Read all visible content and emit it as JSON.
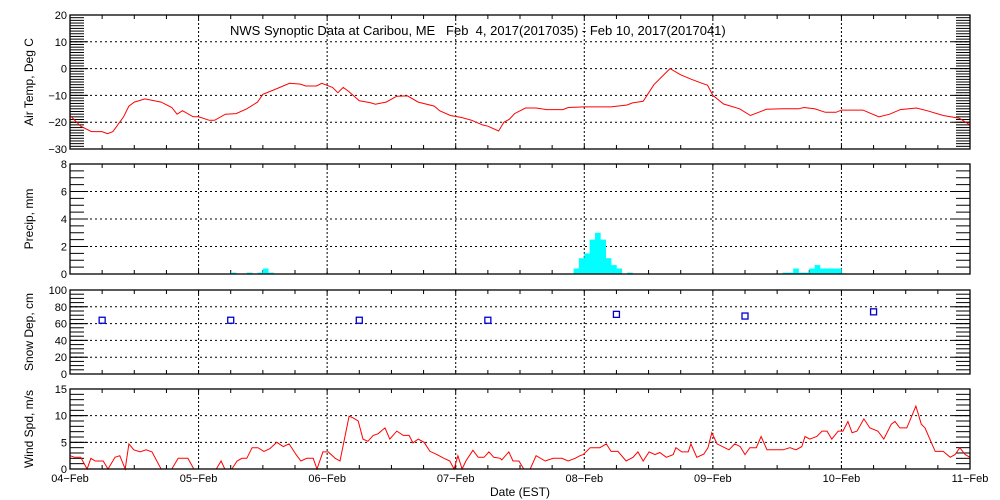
{
  "chart_data": [
    {
      "type": "line",
      "id": "temp",
      "title": "NWS Synoptic Data at Caribou, ME   Feb  4, 2017(2017035) - Feb 10, 2017(2017041)",
      "ylabel": "Air Temp, Deg C",
      "ylim": [
        -30,
        20
      ],
      "yticks": [
        20,
        10,
        0,
        -10,
        -20,
        -30
      ],
      "yminor": 1,
      "x_unit": "hours since 04-Feb 00:00 EST",
      "color": "#ff0000",
      "points": [
        [
          0,
          -17.5
        ],
        [
          2,
          -21.5
        ],
        [
          4,
          -23.5
        ],
        [
          6,
          -23.5
        ],
        [
          7,
          -24.3
        ],
        [
          8,
          -23.5
        ],
        [
          10,
          -18
        ],
        [
          11,
          -14
        ],
        [
          12,
          -12.5
        ],
        [
          14,
          -11.3
        ],
        [
          17,
          -12.5
        ],
        [
          19,
          -14.5
        ],
        [
          20,
          -17
        ],
        [
          21,
          -15.7
        ],
        [
          23,
          -18
        ],
        [
          24,
          -18
        ],
        [
          26,
          -19.3
        ],
        [
          27,
          -19.3
        ],
        [
          29,
          -17
        ],
        [
          31,
          -16.8
        ],
        [
          33,
          -15
        ],
        [
          35,
          -12.5
        ],
        [
          36,
          -9.6
        ],
        [
          38,
          -8
        ],
        [
          41,
          -5.5
        ],
        [
          43,
          -5.8
        ],
        [
          44,
          -6.5
        ],
        [
          46,
          -6.5
        ],
        [
          47,
          -5.5
        ],
        [
          49,
          -7
        ],
        [
          50,
          -9
        ],
        [
          51,
          -7
        ],
        [
          52,
          -8.5
        ],
        [
          54,
          -12
        ],
        [
          56,
          -12.7
        ],
        [
          57,
          -13.3
        ],
        [
          59,
          -12.5
        ],
        [
          61,
          -10.3
        ],
        [
          63,
          -10.2
        ],
        [
          65,
          -12.5
        ],
        [
          68,
          -14
        ],
        [
          69,
          -15.7
        ],
        [
          71,
          -17.5
        ],
        [
          73,
          -18.2
        ],
        [
          75,
          -19.3
        ],
        [
          77,
          -21
        ],
        [
          78,
          -21.5
        ],
        [
          80,
          -23.3
        ],
        [
          81,
          -20
        ],
        [
          82,
          -18.9
        ],
        [
          83,
          -16.8
        ],
        [
          85,
          -14.7
        ],
        [
          87,
          -14.7
        ],
        [
          89,
          -15.3
        ],
        [
          92,
          -15.3
        ],
        [
          93,
          -14.5
        ],
        [
          96,
          -14.3
        ],
        [
          101,
          -14.3
        ],
        [
          104,
          -13.6
        ],
        [
          105,
          -12.8
        ],
        [
          107,
          -12.2
        ],
        [
          109,
          -6
        ],
        [
          112,
          0
        ],
        [
          114,
          -2.3
        ],
        [
          116,
          -4
        ],
        [
          118,
          -5.5
        ],
        [
          119,
          -6.2
        ],
        [
          120,
          -10
        ],
        [
          122,
          -13.2
        ],
        [
          125,
          -15
        ],
        [
          127,
          -17.5
        ],
        [
          130,
          -15.2
        ],
        [
          133,
          -15
        ],
        [
          136,
          -15
        ],
        [
          137,
          -14.5
        ],
        [
          139,
          -15
        ],
        [
          141,
          -16.3
        ],
        [
          143,
          -16.3
        ],
        [
          144,
          -15.5
        ],
        [
          148,
          -15.5
        ],
        [
          151,
          -18
        ],
        [
          153,
          -17
        ],
        [
          155,
          -15.3
        ],
        [
          158,
          -14.7
        ],
        [
          160,
          -15.7
        ],
        [
          163,
          -17.5
        ],
        [
          166,
          -18.5
        ],
        [
          168,
          -21
        ]
      ]
    },
    {
      "type": "bar",
      "id": "precip",
      "ylabel": "Precip, mm",
      "ylim": [
        0,
        8
      ],
      "yticks": [
        8,
        6,
        4,
        2,
        0
      ],
      "yminor": 0.5,
      "x_unit": "hour index (1-hour bins) since 04-Feb 00:00 EST",
      "color": "#00ffff",
      "bars": [
        [
          30,
          0.1
        ],
        [
          33,
          0.1
        ],
        [
          35,
          0.1
        ],
        [
          36,
          0.4
        ],
        [
          37,
          0.1
        ],
        [
          94,
          0.4
        ],
        [
          95,
          1.15
        ],
        [
          96,
          1.5
        ],
        [
          97,
          2.5
        ],
        [
          98,
          3.0
        ],
        [
          99,
          2.5
        ],
        [
          100,
          1.15
        ],
        [
          101,
          0.65
        ],
        [
          102,
          0.4
        ],
        [
          104,
          0.1
        ],
        [
          133,
          0.1
        ],
        [
          134,
          0.1
        ],
        [
          135,
          0.4
        ],
        [
          136,
          0.1
        ],
        [
          137,
          0.1
        ],
        [
          138,
          0.4
        ],
        [
          139,
          0.65
        ],
        [
          140,
          0.4
        ],
        [
          141,
          0.4
        ],
        [
          142,
          0.4
        ],
        [
          143,
          0.4
        ],
        [
          144,
          0.05
        ]
      ]
    },
    {
      "type": "scatter",
      "id": "snow",
      "ylabel": "Snow Dep, cm",
      "ylim": [
        0,
        100
      ],
      "yticks": [
        100,
        80,
        60,
        40,
        20,
        0
      ],
      "yminor": 5,
      "x_unit": "hours since 04-Feb 00:00 EST",
      "color": "#0000cc",
      "points": [
        [
          6,
          64
        ],
        [
          30,
          64
        ],
        [
          54,
          64
        ],
        [
          78,
          64
        ],
        [
          102,
          71
        ],
        [
          126,
          69
        ],
        [
          150,
          74
        ]
      ]
    },
    {
      "type": "line",
      "id": "wind",
      "ylabel": "Wind Spd, m/s",
      "xlabel": "Date (EST)",
      "ylim": [
        0,
        15
      ],
      "yticks": [
        15,
        10,
        5,
        0
      ],
      "yminor": 1,
      "x_unit": "hours since 04-Feb 00:00 EST",
      "color": "#ff0000",
      "xticks": [
        "04-Feb",
        "05-Feb",
        "06-Feb",
        "07-Feb",
        "08-Feb",
        "09-Feb",
        "10-Feb",
        "11-Feb"
      ],
      "points": [
        [
          0,
          2.5
        ],
        [
          0.9,
          2.2
        ],
        [
          2,
          2.2
        ],
        [
          3.2,
          0
        ],
        [
          3.9,
          2
        ],
        [
          4.7,
          1.5
        ],
        [
          6.2,
          1.5
        ],
        [
          7.1,
          0
        ],
        [
          8.4,
          2.2
        ],
        [
          9.3,
          2.5
        ],
        [
          10.3,
          0
        ],
        [
          11,
          4.7
        ],
        [
          11.9,
          3.6
        ],
        [
          13.1,
          3.2
        ],
        [
          14.2,
          3.6
        ],
        [
          15.3,
          3.2
        ],
        [
          17,
          0
        ],
        [
          19,
          0
        ],
        [
          20.2,
          2
        ],
        [
          22,
          2
        ],
        [
          23.1,
          0
        ],
        [
          27.3,
          0
        ],
        [
          28.2,
          1.5
        ],
        [
          28.9,
          0
        ],
        [
          30.2,
          0
        ],
        [
          31.2,
          1.5
        ],
        [
          32.1,
          2
        ],
        [
          33,
          2
        ],
        [
          34,
          4
        ],
        [
          35.1,
          4
        ],
        [
          36.2,
          3.3
        ],
        [
          37.3,
          3.8
        ],
        [
          38.6,
          5
        ],
        [
          39.8,
          4.2
        ],
        [
          40.9,
          4.7
        ],
        [
          42.2,
          2.7
        ],
        [
          43.1,
          1.5
        ],
        [
          44.2,
          2
        ],
        [
          45.4,
          2
        ],
        [
          46.1,
          0
        ],
        [
          47.2,
          3.2
        ],
        [
          48.2,
          3.2
        ],
        [
          49.5,
          2
        ],
        [
          50.4,
          1.5
        ],
        [
          52.1,
          9.9
        ],
        [
          52.8,
          9.6
        ],
        [
          53.8,
          9
        ],
        [
          54.7,
          5.6
        ],
        [
          55.6,
          5.2
        ],
        [
          56.6,
          6.3
        ],
        [
          57.5,
          6.6
        ],
        [
          58.8,
          7.7
        ],
        [
          59.7,
          5.6
        ],
        [
          61,
          7.1
        ],
        [
          62.2,
          6.3
        ],
        [
          63.3,
          6.3
        ],
        [
          64,
          4.9
        ],
        [
          65,
          5.6
        ],
        [
          66.1,
          5
        ],
        [
          67.2,
          3.3
        ],
        [
          68.5,
          2.7
        ],
        [
          69.8,
          2
        ],
        [
          70.9,
          1.5
        ],
        [
          71.7,
          0
        ],
        [
          72.4,
          2.5
        ],
        [
          73.2,
          0
        ],
        [
          73.9,
          1.5
        ],
        [
          75.2,
          3.5
        ],
        [
          76.2,
          2.2
        ],
        [
          77.3,
          2.2
        ],
        [
          78.2,
          3.2
        ],
        [
          79.1,
          2.2
        ],
        [
          80.3,
          2
        ],
        [
          80.6,
          1.7
        ],
        [
          81.9,
          3.2
        ],
        [
          82.7,
          1.5
        ],
        [
          83.8,
          1.5
        ],
        [
          84.7,
          0
        ],
        [
          85.9,
          0
        ],
        [
          87,
          2.5
        ],
        [
          88.7,
          1.5
        ],
        [
          90.2,
          2
        ],
        [
          91.8,
          2
        ],
        [
          93,
          1.5
        ],
        [
          94.3,
          2
        ],
        [
          95.2,
          2.5
        ],
        [
          95.8,
          2.7
        ],
        [
          97.1,
          4
        ],
        [
          98.9,
          4
        ],
        [
          100.1,
          4.7
        ],
        [
          101,
          3.3
        ],
        [
          102.3,
          3.3
        ],
        [
          103.8,
          1.5
        ],
        [
          105.1,
          2.2
        ],
        [
          106,
          3.2
        ],
        [
          107,
          1.5
        ],
        [
          108.1,
          3.2
        ],
        [
          109.2,
          2.7
        ],
        [
          110.1,
          3.1
        ],
        [
          111.3,
          2.2
        ],
        [
          112.6,
          2.7
        ],
        [
          113.1,
          4
        ],
        [
          114.2,
          3.2
        ],
        [
          115.4,
          3.2
        ],
        [
          115.9,
          4.7
        ],
        [
          117,
          2.2
        ],
        [
          118.3,
          2.8
        ],
        [
          119.1,
          4
        ],
        [
          119.8,
          6.8
        ],
        [
          120.8,
          4.7
        ],
        [
          123,
          3.6
        ],
        [
          124.1,
          4.7
        ],
        [
          125.1,
          4.2
        ],
        [
          126,
          2.7
        ],
        [
          126.9,
          4
        ],
        [
          128.1,
          4
        ],
        [
          129,
          6.1
        ],
        [
          130.1,
          3.6
        ],
        [
          133.1,
          3.6
        ],
        [
          134.4,
          4
        ],
        [
          135.5,
          3.6
        ],
        [
          136.6,
          4.2
        ],
        [
          137.2,
          6.1
        ],
        [
          138.1,
          5.6
        ],
        [
          139.4,
          6.1
        ],
        [
          140.4,
          7.1
        ],
        [
          141.3,
          7.1
        ],
        [
          142.2,
          5.6
        ],
        [
          143.4,
          7.1
        ],
        [
          144.3,
          7.1
        ],
        [
          145.2,
          8.9
        ],
        [
          146,
          6.8
        ],
        [
          146.9,
          7.1
        ],
        [
          148.2,
          9.4
        ],
        [
          149.3,
          7.7
        ],
        [
          150.8,
          7.1
        ],
        [
          151.9,
          5.6
        ],
        [
          153.3,
          8.4
        ],
        [
          154,
          8.9
        ],
        [
          154.9,
          7.7
        ],
        [
          156.2,
          7.7
        ],
        [
          157.9,
          11.8
        ],
        [
          158.9,
          8.4
        ],
        [
          159.6,
          7.7
        ],
        [
          161.5,
          3.3
        ],
        [
          163,
          3.3
        ],
        [
          164.3,
          2.2
        ],
        [
          165.2,
          2.7
        ],
        [
          166.1,
          4
        ],
        [
          167.1,
          2.7
        ],
        [
          168,
          2.2
        ]
      ]
    }
  ]
}
